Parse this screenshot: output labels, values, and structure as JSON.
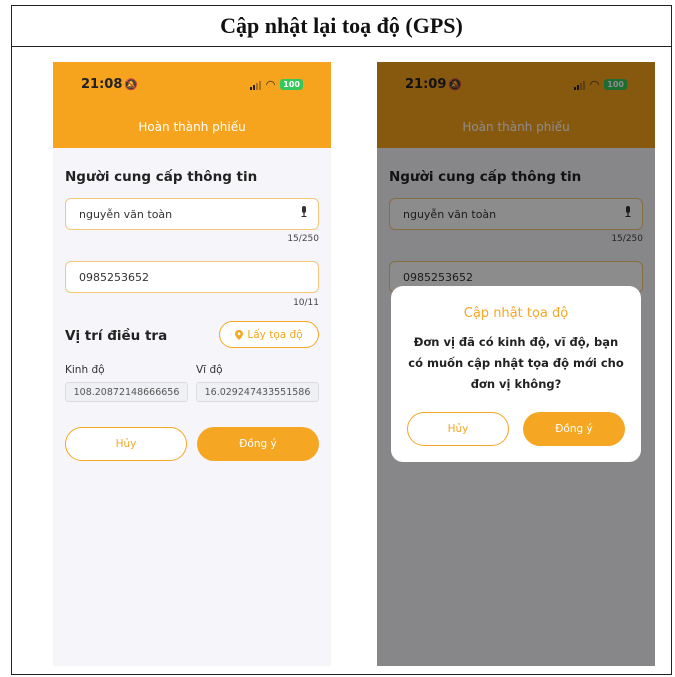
{
  "caption": "Cập nhật lại toạ độ (GPS)",
  "status": {
    "time": "21:08",
    "time2": "21:09",
    "battery": "100"
  },
  "header": {
    "title": "Hoàn thành phiếu"
  },
  "section_informant": "Người cung cấp thông tin",
  "name_field": {
    "value": "nguyễn văn toàn",
    "counter": "15/250"
  },
  "phone_field": {
    "value": "0985253652",
    "counter": "10/11"
  },
  "section_location": "Vị trí điều tra",
  "get_coords_label": "Lấy tọa độ",
  "longitude": {
    "label": "Kinh độ",
    "value": "108.20872148666656"
  },
  "latitude": {
    "label": "Vĩ độ",
    "value": "16.029247433551586"
  },
  "buttons": {
    "cancel": "Hủy",
    "ok": "Đồng ý"
  },
  "dialog": {
    "title": "Cập nhật tọa độ",
    "message": "Đơn vị đã có kinh độ, vĩ độ, bạn có muốn cập nhật tọa độ mới cho đơn vị không?",
    "cancel": "Hủy",
    "ok": "Đồng ý"
  },
  "colors": {
    "accent": "#f5a623",
    "header": "#f6a31d",
    "battery": "#34c759"
  },
  "icons": [
    "bell-icon",
    "signal-icon",
    "wifi-icon",
    "battery-icon",
    "mic-icon",
    "location-pin-icon"
  ]
}
